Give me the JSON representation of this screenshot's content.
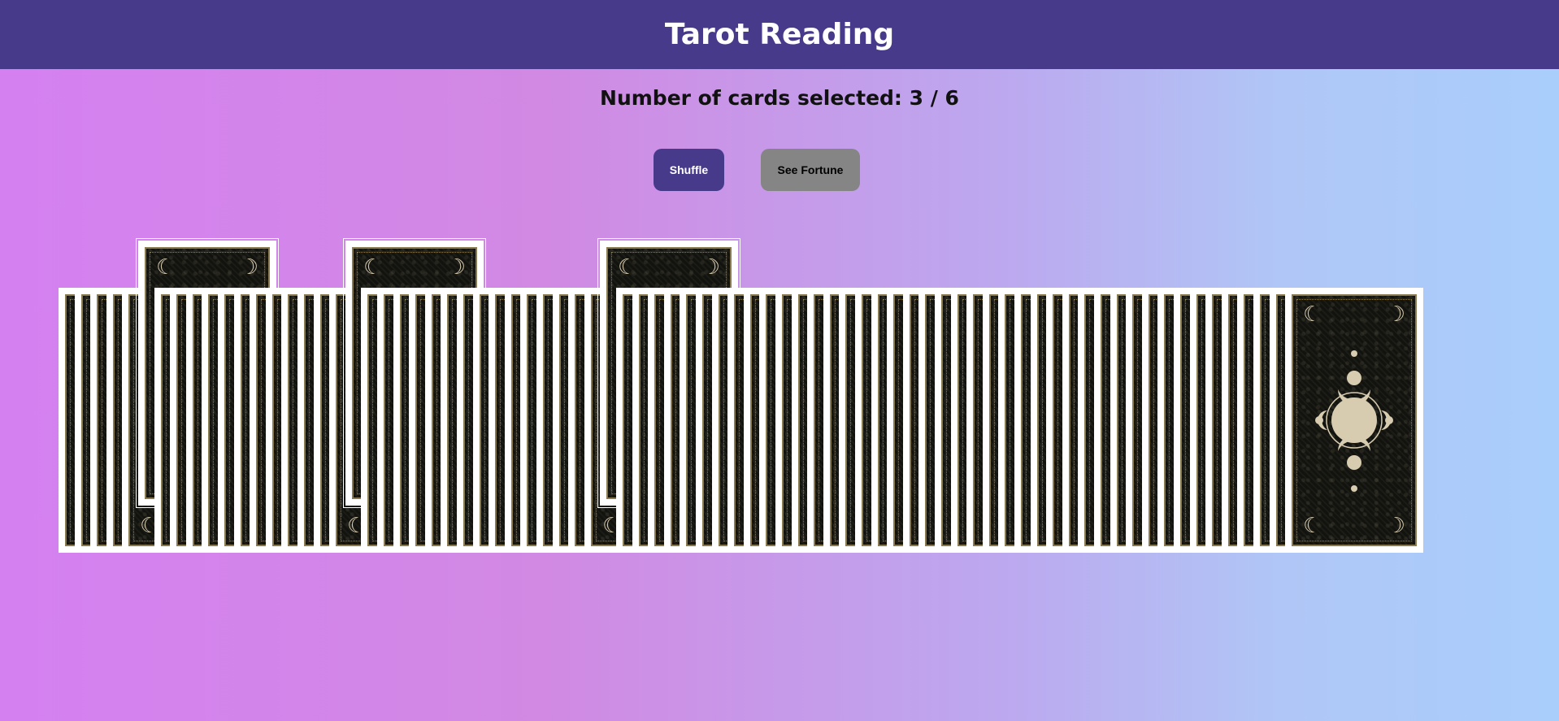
{
  "header": {
    "title": "Tarot Reading"
  },
  "status": {
    "selection_text": "Number of cards selected: 3 / 6",
    "selected_count": 3,
    "max_count": 6
  },
  "controls": {
    "shuffle_label": "Shuffle",
    "fortune_label": "See Fortune"
  },
  "deck": {
    "total_cards": 78,
    "selected_positions": [
      5,
      18,
      34
    ],
    "card_back": {
      "corner_icon": "crescent-moon-icon",
      "center_icon": "triple-moon-emblem-icon",
      "accent_color": "#d8ccb0",
      "background_color": "#141410",
      "border_color": "#8a7a4f"
    }
  },
  "colors": {
    "header_bg": "#473a8b",
    "shuffle_bg": "#473a8b",
    "fortune_bg": "#858585"
  }
}
